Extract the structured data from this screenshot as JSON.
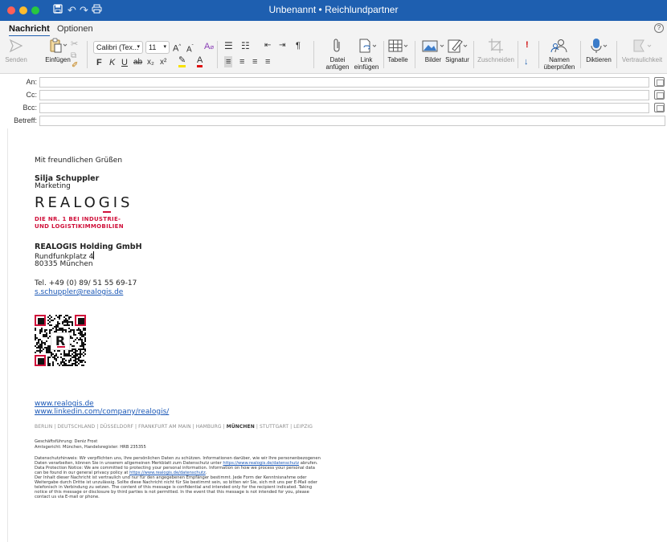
{
  "window": {
    "title": "Unbenannt • Reichlundpartner",
    "traffic_colors": {
      "close": "#ff5f57",
      "minimize": "#febc2e",
      "zoom": "#28c840"
    },
    "titlebar_color": "#1e5fb0"
  },
  "tabs": [
    {
      "label": "Nachricht",
      "active": true
    },
    {
      "label": "Optionen",
      "active": false
    }
  ],
  "ribbon": {
    "send": "Senden",
    "paste": "Einfügen",
    "font_name": "Calibri (Tex...",
    "font_size": "11",
    "bold": "F",
    "italic": "K",
    "underline": "U",
    "strike": "ab",
    "subscript": "x₂",
    "superscript": "x²",
    "paragraph": "¶",
    "attach_file": "Datei\nanfügen",
    "attach_file_l1": "Datei",
    "attach_file_l2": "anfügen",
    "attach_link_l1": "Link",
    "attach_link_l2": "einfügen",
    "table": "Tabelle",
    "pictures": "Bilder",
    "signature": "Signatur",
    "crop": "Zuschneiden",
    "check_names_l1": "Namen",
    "check_names_l2": "überprüfen",
    "dictate": "Diktieren",
    "sensitivity": "Vertraulichkeit"
  },
  "fields": {
    "to_label": "An:",
    "cc_label": "Cc:",
    "bcc_label": "Bcc:",
    "subject_label": "Betreff:",
    "to_value": "",
    "cc_value": "",
    "bcc_value": "",
    "subject_value": ""
  },
  "signature": {
    "greeting": "Mit freundlichen Grüßen",
    "name": "Silja Schuppler",
    "role": "Marketing",
    "logo_text": "REALOGIS",
    "tagline_1": "DIE NR. 1 BEI INDUSTRIE-",
    "tagline_2": "UND LOGISTIKIMMOBILIEN",
    "company": "REALOGIS Holding GmbH",
    "street": "Rundfunkplatz 4",
    "city": "80335 München",
    "phone": "Tel. +49 (0) 89/ 51 55 69-17",
    "email": "s.schuppler@realogis.de",
    "qr_letter": "R",
    "website": "www.realogis.de",
    "linkedin": "www.linkedin.com/company/realogis/",
    "cities_before": "BERLIN | DEUTSCHLAND | DÜSSELDORF | FRANKFURT AM MAIN | HAMBURG | ",
    "cities_bold": "MÜNCHEN",
    "cities_after": " | STUTTGART | LEIPZIG",
    "management": "Geschäftsführung: Deniz Frost",
    "register": "Amtsgericht: München, Handelsregister: HRB 235355",
    "privacy_1": "Datenschutzhinweis: Wir verpflichten uns, Ihre persönlichen Daten zu schützen. Informationen darüber, wie wir Ihre personenbezogenen",
    "privacy_2a": "Daten verarbeiten, können Sie in unserem allgemeinen Merkblatt zum Datenschutz unter ",
    "privacy_2_link": "https://www.realogis.de/datenschutz",
    "privacy_2b": " abrufen.",
    "privacy_3": "Data Protection Notice: We are committed to protecting your personal information. Information on how we process your personal data",
    "privacy_4a": "can be found in our general privacy policy at ",
    "privacy_4_link": "https://www.realogis.de/datenschutz",
    "privacy_4b": ".",
    "conf_1": "Der Inhalt dieser Nachricht ist vertraulich und nur für den angegebenen Empfänger bestimmt. Jede Form der Kenntnisnahme oder",
    "conf_2": "Weitergabe durch Dritte ist unzulässig. Sollte diese Nachricht nicht für Sie bestimmt sein, so bitten wir Sie, sich mit uns per E-Mail oder",
    "conf_3": "telefonisch in Verbindung zu setzen. The content of this message is confidential and intended only for the recipient indicated. Taking",
    "conf_4": "notice of this message or disclosure by third parties is not permitted. In the event that this message is not intended for you, please",
    "conf_5": "contact us via E-mail or phone."
  },
  "colors": {
    "brand_red": "#d0103a",
    "link_blue": "#1a57b6",
    "accent_blue": "#1e5fb0"
  }
}
